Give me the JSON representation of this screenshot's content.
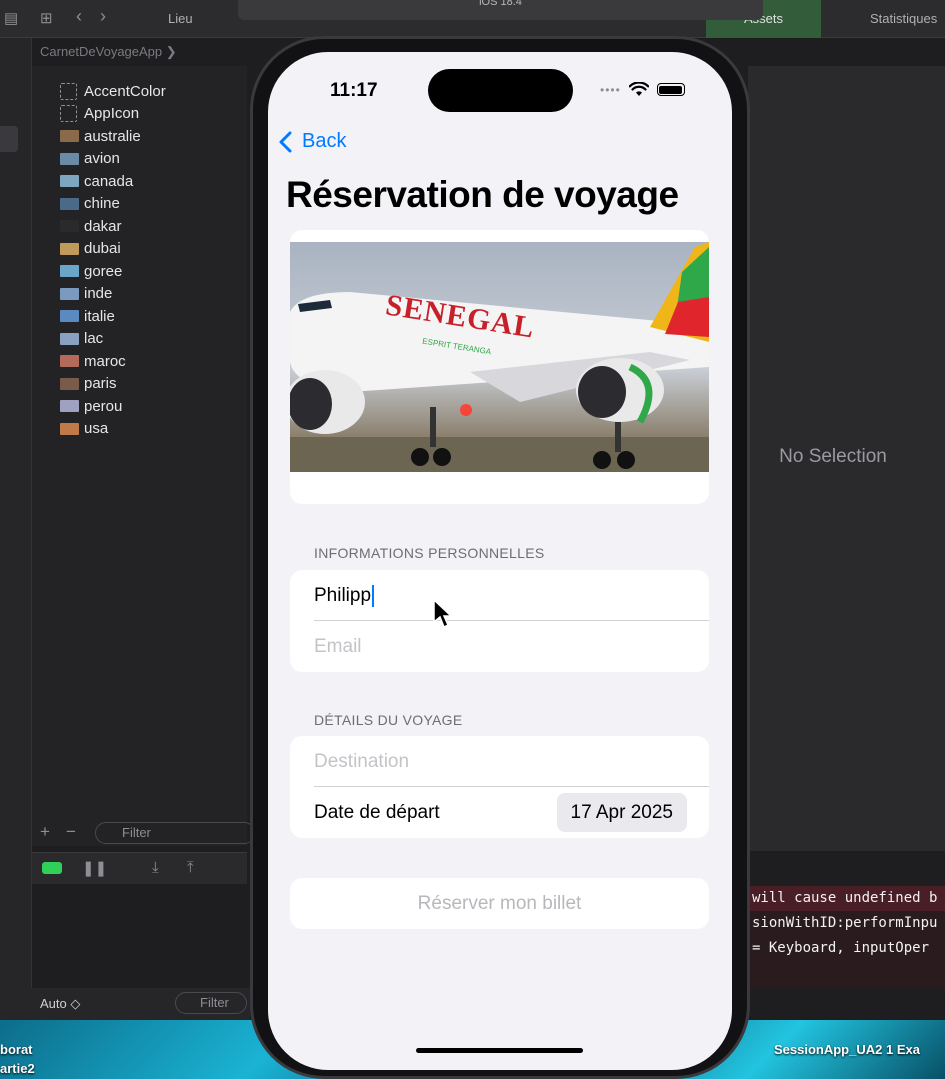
{
  "xcode": {
    "tabs": {
      "lieu": "Lieu",
      "assets": "Assets",
      "stats": "Statistiques"
    },
    "sim_label": "iOS 18.4",
    "breadcrumb": "CarnetDeVoyageApp ❯",
    "assets": [
      "AccentColor",
      "AppIcon",
      "australie",
      "avion",
      "canada",
      "chine",
      "dakar",
      "dubai",
      "goree",
      "inde",
      "italie",
      "lac",
      "maroc",
      "paris",
      "perou",
      "usa"
    ],
    "filter_placeholder": "Filter",
    "debug_auto": "Auto ◇",
    "no_selection": "No Selection",
    "console_lines": [
      "will cause undefined b",
      "sionWithID:performInpu",
      " = Keyboard, inputOper"
    ],
    "dock_left": [
      "borat",
      "artie2"
    ],
    "dock_right": "SessionApp_UA2 1  Exa"
  },
  "status_bar": {
    "time": "11:17"
  },
  "nav": {
    "back_label": "Back"
  },
  "page": {
    "title": "Réservation de voyage"
  },
  "hero": {
    "livery": "SENEGAL",
    "sub": "ESPRIT TERANGA"
  },
  "form": {
    "personal_header": "INFORMATIONS PERSONNELLES",
    "name_value": "Philipp",
    "email_placeholder": "Email",
    "trip_header": "DÉTAILS DU VOYAGE",
    "destination_placeholder": "Destination",
    "date_label": "Date de départ",
    "date_value": "17 Apr 2025",
    "reserve_label": "Réserver mon billet"
  },
  "colors": {
    "accent": "#007aff",
    "background": "#f2f2f7",
    "card": "#ffffff"
  }
}
